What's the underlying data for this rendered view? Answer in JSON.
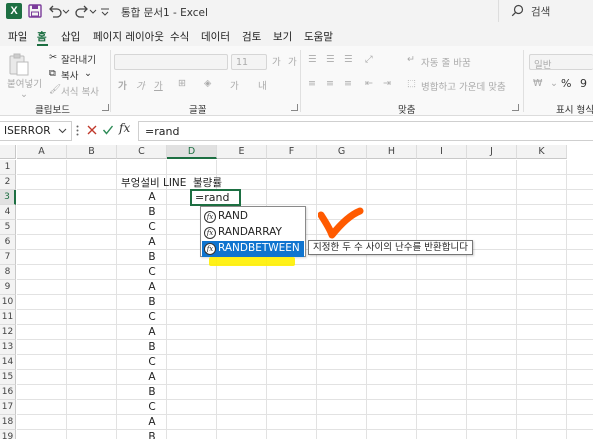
{
  "app": {
    "logo_letter": "X",
    "title": "통합 문서1 - Excel",
    "search_placeholder": "검색"
  },
  "menu": {
    "tabs": [
      "파일",
      "홈",
      "삽입",
      "페이지 레이아웃",
      "수식",
      "데이터",
      "검토",
      "보기",
      "도움말"
    ],
    "active_tab": "홈"
  },
  "ribbon": {
    "clipboard": {
      "paste_label": "붙여넣기",
      "cut_label": "잘라내기",
      "copy_label": "복사",
      "format_painter_label": "서식 복사",
      "group_label": "클립보드"
    },
    "font": {
      "font_size": "11",
      "group_label": "글꼴"
    },
    "alignment": {
      "wrap_text_label": "자동 줄 바꿈",
      "merge_label": "병합하고 가운데 맞춤",
      "group_label": "맞춤"
    },
    "number": {
      "format_value": "일반",
      "group_label": "표시 형식"
    }
  },
  "formula_bar": {
    "name_box": "ISERROR",
    "formula": "=rand",
    "fx_label": "fx"
  },
  "grid": {
    "columns": [
      "A",
      "B",
      "C",
      "D",
      "E",
      "F",
      "G",
      "H",
      "I",
      "J",
      "K"
    ],
    "selected_column": "D",
    "rows": [
      "1",
      "2",
      "3",
      "4",
      "5",
      "6",
      "7",
      "8",
      "9",
      "10",
      "11",
      "12",
      "13",
      "14",
      "15",
      "16",
      "17",
      "18",
      "19"
    ],
    "selected_row": "3",
    "header_c2": "부엉설비 LINE",
    "header_d2": "불량률",
    "column_c_values": [
      "A",
      "B",
      "C",
      "A",
      "B",
      "C",
      "A",
      "B",
      "C",
      "A",
      "B",
      "C",
      "A",
      "B",
      "C",
      "A",
      "B"
    ],
    "active_cell_text": "=rand"
  },
  "autocomplete": {
    "items": [
      "RAND",
      "RANDARRAY",
      "RANDBETWEEN"
    ],
    "selected_index": 2,
    "tooltip": "지정한 두 수 사이의 난수를 반환합니다"
  },
  "colors": {
    "accent": "#1d6f42",
    "selection_blue": "#0f74cf",
    "annotation_orange": "#ff5a00",
    "annotation_yellow": "#ffef00"
  }
}
